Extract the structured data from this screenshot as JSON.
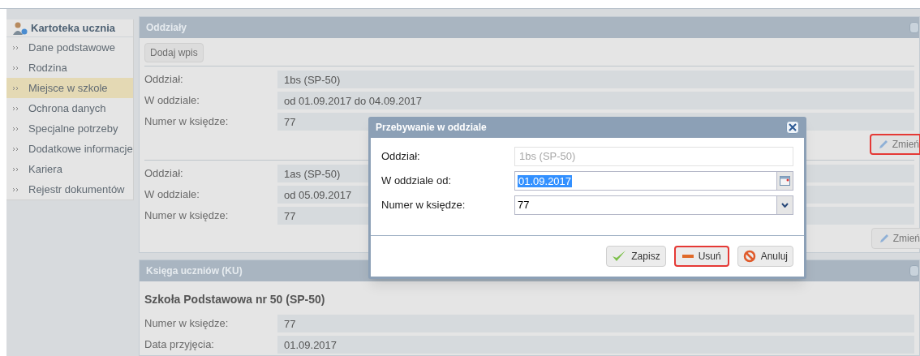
{
  "sidebar": {
    "title": "Kartoteka ucznia",
    "items": [
      {
        "label": "Dane podstawowe",
        "selected": false
      },
      {
        "label": "Rodzina",
        "selected": false
      },
      {
        "label": "Miejsce w szkole",
        "selected": true
      },
      {
        "label": "Ochrona danych",
        "selected": false
      },
      {
        "label": "Specjalne potrzeby",
        "selected": false
      },
      {
        "label": "Dodatkowe informacje",
        "selected": false
      },
      {
        "label": "Kariera",
        "selected": false
      },
      {
        "label": "Rejestr dokumentów",
        "selected": false
      }
    ]
  },
  "oddzialy": {
    "title": "Oddziały",
    "add_button": "Dodaj wpis",
    "records": [
      {
        "fields": [
          {
            "label": "Oddział:",
            "value": "1bs (SP-50)"
          },
          {
            "label": "W oddziale:",
            "value": "od 01.09.2017 do 04.09.2017"
          },
          {
            "label": "Numer w księdze:",
            "value": "77"
          }
        ],
        "edit_button": {
          "label": "Zmień",
          "highlighted": true
        }
      },
      {
        "fields": [
          {
            "label": "Oddział:",
            "value": "1as (SP-50)"
          },
          {
            "label": "W oddziale:",
            "value": "od 05.09.2017"
          },
          {
            "label": "Numer w księdze:",
            "value": "77"
          }
        ],
        "edit_button": {
          "label": "Zmień",
          "highlighted": false
        }
      }
    ]
  },
  "ksiega": {
    "title": "Księga uczniów (KU)",
    "school": "Szkoła Podstawowa nr 50 (SP-50)",
    "fields": [
      {
        "label": "Numer w księdze:",
        "value": "77"
      },
      {
        "label": "Data przyjęcia:",
        "value": "01.09.2017"
      }
    ]
  },
  "dialog": {
    "title": "Przebywanie w oddziale",
    "fields": [
      {
        "kind": "readonly",
        "label": "Oddział:",
        "value": "1bs (SP-50)"
      },
      {
        "kind": "date",
        "label": "W oddziale od:",
        "value": "01.09.2017"
      },
      {
        "kind": "select",
        "label": "Numer w księdze:",
        "value": "77"
      }
    ],
    "buttons": [
      {
        "kind": "save",
        "label": "Zapisz",
        "highlighted": false
      },
      {
        "kind": "delete",
        "label": "Usuń",
        "highlighted": true
      },
      {
        "kind": "cancel",
        "label": "Anuluj",
        "highlighted": false
      }
    ]
  }
}
